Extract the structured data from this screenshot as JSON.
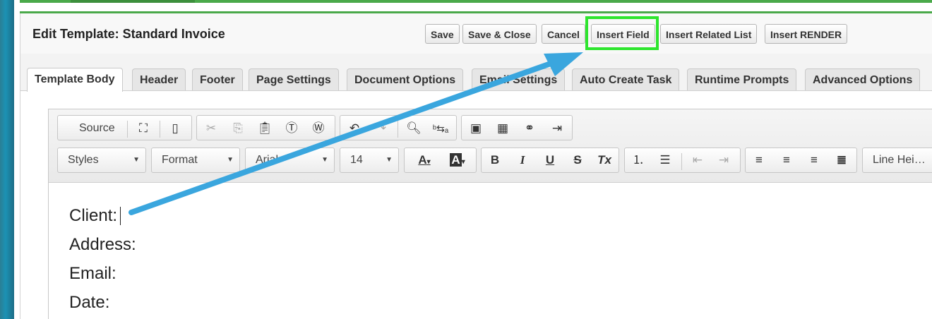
{
  "window": {
    "title": "Edit Template: Standard Invoice"
  },
  "header_buttons": [
    "Save",
    "Save & Close",
    "Cancel",
    "Insert Field",
    "Insert Related List",
    "Insert RENDER"
  ],
  "highlight": {
    "target": "Insert Field",
    "color": "#2ee52e"
  },
  "tabs": [
    "Template Body",
    "Header",
    "Footer",
    "Page Settings",
    "Document Options",
    "Email Settings",
    "Auto Create Task",
    "Runtime Prompts",
    "Advanced Options"
  ],
  "active_tab": "Template Body",
  "toolbar": {
    "source_label": "Source",
    "styles": "Styles",
    "format": "Format",
    "font": "Arial",
    "size": "14",
    "line_height": "Line Hei…",
    "icons_row1": [
      "maximize-icon",
      "show-blocks-icon",
      "cut-icon",
      "copy-icon",
      "paste-icon",
      "paste-text-icon",
      "paste-word-icon",
      "undo-icon",
      "redo-icon",
      "find-icon",
      "replace-icon",
      "image-icon",
      "table-icon",
      "link-icon",
      "page-break-icon"
    ],
    "format_buttons": {
      "bold": "B",
      "italic": "I",
      "underline": "U",
      "strike": "S",
      "clear": "Tx",
      "text_color": "A",
      "bg_color": "A"
    }
  },
  "editor_content": [
    "Client:",
    "Address:",
    "Email:",
    "Date:"
  ],
  "annotation": {
    "arrow_color": "#3aa6de"
  },
  "colors": {
    "accent_green": "#4aa94a",
    "highlight_green": "#2ee52e",
    "arrow_blue": "#3aa6de"
  }
}
